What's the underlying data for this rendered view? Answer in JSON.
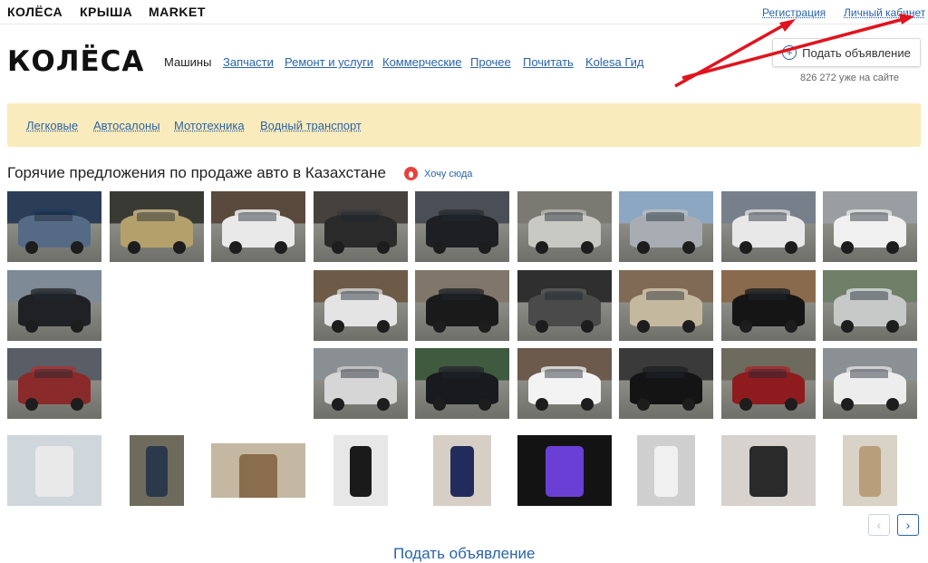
{
  "topbar": {
    "brands": [
      "КОЛЁСА",
      "КРЫША",
      "MARKET"
    ],
    "register": "Регистрация",
    "cabinet": "Личный кабинет"
  },
  "header": {
    "logo": "КОЛЁСА",
    "nav": [
      "Машины",
      "Запчасти",
      "Ремонт и услуги",
      "Коммерческие",
      "Прочее",
      "Почитать",
      "Kolesa Гид"
    ],
    "post_button": "Подать объявление",
    "users_online": "826 272 уже на сайте"
  },
  "categories": [
    "Легковые",
    "Автосалоны",
    "Мототехника",
    "Водный транспорт"
  ],
  "hot": {
    "title": "Горячие предложения по продаже авто в Казахстане",
    "want_here": "Хочу сюда"
  },
  "listing_images": [
    "car-blue-sedan",
    "car-gold-minivan",
    "car-white-hatchback",
    "car-dark-sedan",
    "car-black-suv",
    "car-silver-classic-sedan",
    "car-silver-sedan",
    "car-white-hatchback-2",
    "car-white-minivan",
    "car-black-suv-2",
    "car-white-sedan-2",
    "car-black-suv-3",
    "car-interior",
    "car-beige-wagon",
    "car-black-sedan",
    "car-silver-minivan",
    "car-garage-red",
    "car-silver-suv",
    "car-black-suv-4",
    "car-white-sedan-3",
    "car-black-engine",
    "car-red-sedan",
    "car-white-van"
  ],
  "market_images": [
    "tow-truck",
    "phone-hand",
    "bicycle",
    "phone-black",
    "phone-samsung",
    "phone-screen",
    "phone-box",
    "steering-wheel",
    "phone-gold"
  ],
  "pager": {
    "prev": "‹",
    "next": "›"
  },
  "bottom_cta": "Подать объявление",
  "colors": {
    "link": "#2a64a8",
    "category_bar": "#faebbc",
    "hot_icon": "#e8413b",
    "annotation_arrow": "#e0141e"
  }
}
